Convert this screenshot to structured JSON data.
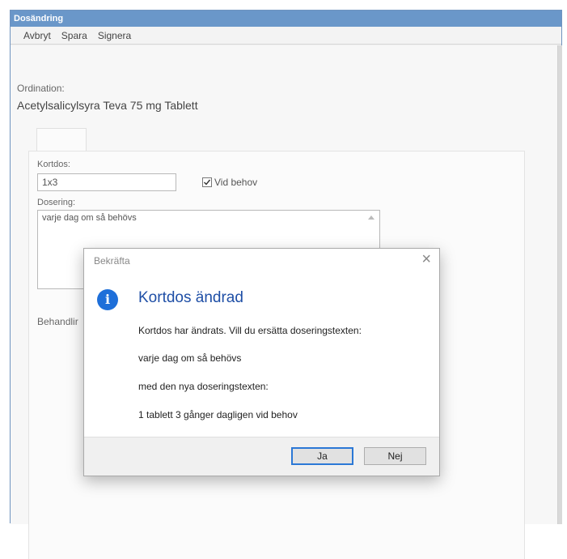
{
  "window": {
    "title": "Dosändring"
  },
  "menu": {
    "cancel": "Avbryt",
    "save": "Spara",
    "sign": "Signera"
  },
  "ordination": {
    "label": "Ordination:",
    "value": "Acetylsalicylsyra Teva 75 mg Tablett"
  },
  "form": {
    "short_dose_label": "Kortdos:",
    "short_dose_value": "1x3",
    "as_needed_label": "Vid behov",
    "as_needed_checked": true,
    "dosage_label": "Dosering:",
    "dosage_value": "varje dag om så behövs",
    "treatment_label_partial": "Behandlir"
  },
  "dialog": {
    "title": "Bekräfta",
    "close_glyph": "×",
    "icon": "info-icon",
    "heading": "Kortdos ändrad",
    "line1": "Kortdos har ändrats. Vill du ersätta doseringstexten:",
    "old_text": "varje dag om så behövs",
    "line2": "med den nya doseringstexten:",
    "new_text": "1 tablett 3 gånger dagligen vid behov",
    "yes_button": "Ja",
    "no_button": "Nej"
  },
  "colors": {
    "titlebar": "#6a97c9",
    "accent": "#1e6fd9",
    "heading": "#1f4fa6"
  }
}
